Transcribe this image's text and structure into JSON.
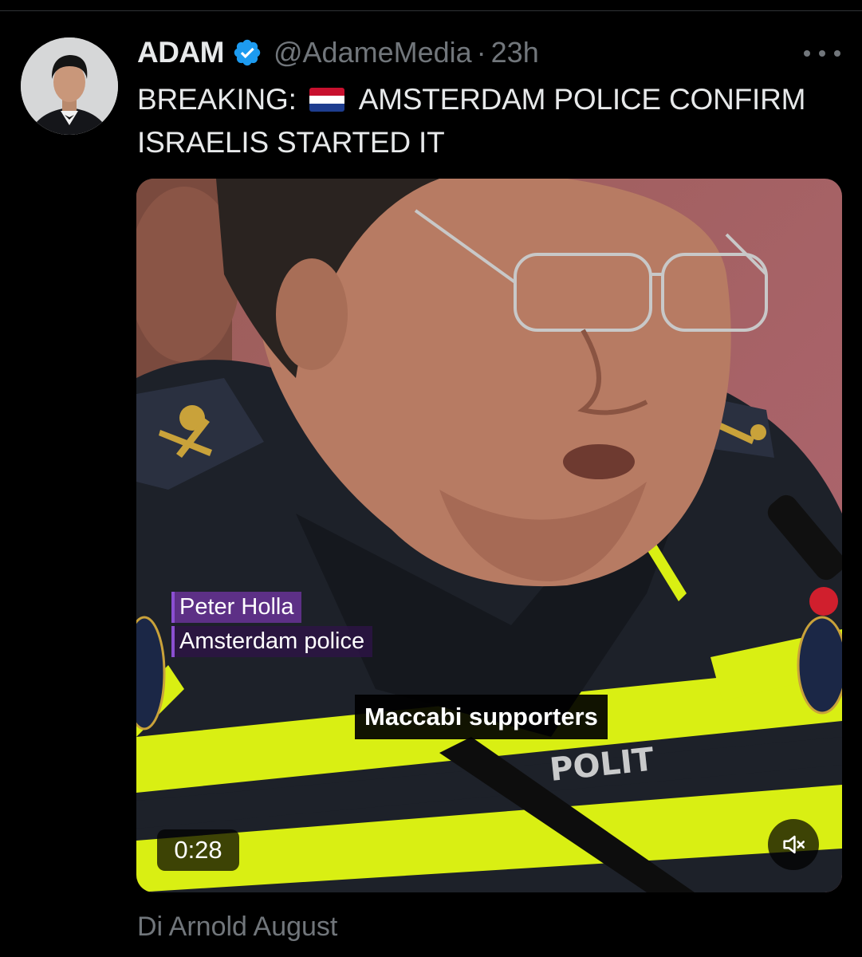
{
  "tweet": {
    "author": {
      "display_name": "ADAM",
      "handle": "@AdameMedia",
      "verified": true,
      "verified_color": "#1d9bf0"
    },
    "separator": "·",
    "timestamp": "23h",
    "more_icon": "more-horizontal-icon",
    "text_prefix": "BREAKING:",
    "flag_icon": "netherlands-flag",
    "text_body": "AMSTERDAM POLICE CONFIRM ISRAELIS STARTED IT"
  },
  "video": {
    "lower_third": {
      "name": "Peter Holla",
      "title": "Amsterdam police"
    },
    "subtitle": "Maccabi supporters",
    "duration": "0:28",
    "mute_icon": "volume-muted-icon"
  },
  "credit": "Di Arnold August",
  "colors": {
    "background": "#000000",
    "primary_text": "#e7e9ea",
    "secondary_text": "#71767b",
    "uniform_yellow": "#d9ef13"
  }
}
